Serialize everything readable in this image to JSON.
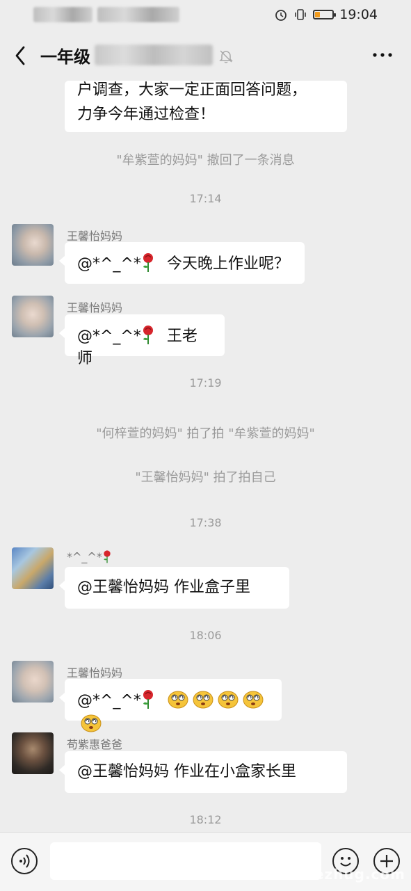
{
  "status_bar": {
    "time": "19:04",
    "battery_level": 0.25,
    "battery_color": "#f29b1c"
  },
  "header": {
    "title": "一年级"
  },
  "messages": {
    "top_bubble": {
      "line1": "户调查，大家一定正面回答问题，",
      "line2": "力争今年通过检查！"
    },
    "recall": "\"牟紫萱的妈妈\" 撤回了一条消息",
    "t1": "17:14",
    "m1": {
      "sender": "王馨怡妈妈",
      "mention": "@*^_^*",
      "text": "今天晚上作业呢？"
    },
    "m2": {
      "sender": "王馨怡妈妈",
      "mention": "@*^_^*",
      "text": "王老师"
    },
    "t2": "17:19",
    "pat1": "\"何梓萱的妈妈\" 拍了拍 \"牟紫萱的妈妈\"",
    "pat2": "\"王馨怡妈妈\" 拍了拍自己",
    "t3": "17:38",
    "m3": {
      "sender": "*^_^*",
      "text": "@王馨怡妈妈  作业盒子里"
    },
    "t4": "18:06",
    "m4": {
      "sender": "王馨怡妈妈",
      "mention": "@*^_^*",
      "emoji_count": 5
    },
    "m5": {
      "sender": "苟紫惠爸爸",
      "text": "@王馨怡妈妈  作业在小盒家长里"
    },
    "t5": "18:12"
  },
  "icons": {
    "rose": "rose-emoji-icon",
    "face": "dizzy-face-emoji-icon"
  },
  "watermark": "www.uezhug.com"
}
